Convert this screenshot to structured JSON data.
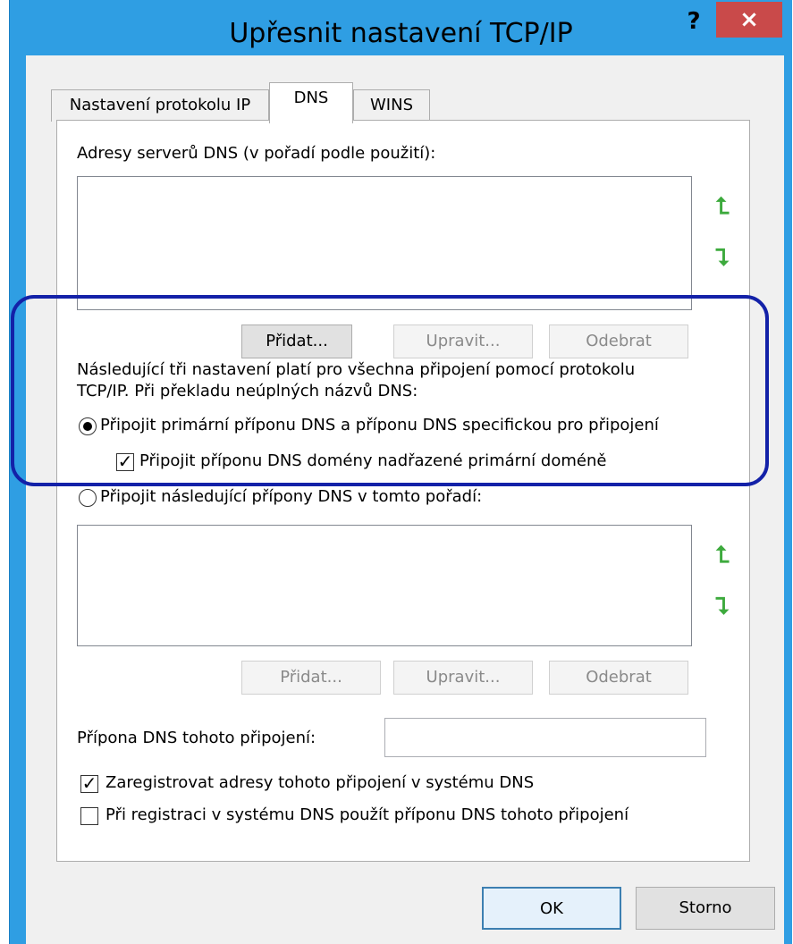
{
  "window": {
    "title": "Upřesnit nastavení TCP/IP",
    "help_label": "?",
    "close_label": "×"
  },
  "tabs": [
    {
      "label": "Nastavení protokolu IP"
    },
    {
      "label": "DNS"
    },
    {
      "label": "WINS"
    }
  ],
  "dns_servers": {
    "label": "Adresy serverů DNS (v pořadí podle použití):",
    "add": "Přidat...",
    "edit": "Upravit...",
    "remove": "Odebrat"
  },
  "resolution": {
    "intro_line1": "Následující tři nastavení platí pro všechna připojení pomocí protokolu",
    "intro_line2": "TCP/IP. Při překladu neúplných názvů DNS:",
    "radio_primary": "Připojit primární příponu DNS a příponu DNS specifickou pro připojení",
    "check_parent": "Připojit příponu DNS domény nadřazené primární doméně",
    "radio_list": "Připojit následující přípony DNS v tomto pořadí:"
  },
  "suffix_list": {
    "add": "Přidat...",
    "edit": "Upravit...",
    "remove": "Odebrat"
  },
  "connection_suffix": {
    "label": "Přípona DNS tohoto připojení:",
    "value": ""
  },
  "options": {
    "register": "Zaregistrovat adresy tohoto připojení v systému DNS",
    "use_suffix": "Při registraci v systému DNS použít příponu DNS tohoto připojení"
  },
  "footer": {
    "ok": "OK",
    "cancel": "Storno"
  },
  "colors": {
    "frame": "#2f9ee3",
    "close": "#c94a4a",
    "arrow": "#3daa3d",
    "highlight": "#1321a8"
  }
}
